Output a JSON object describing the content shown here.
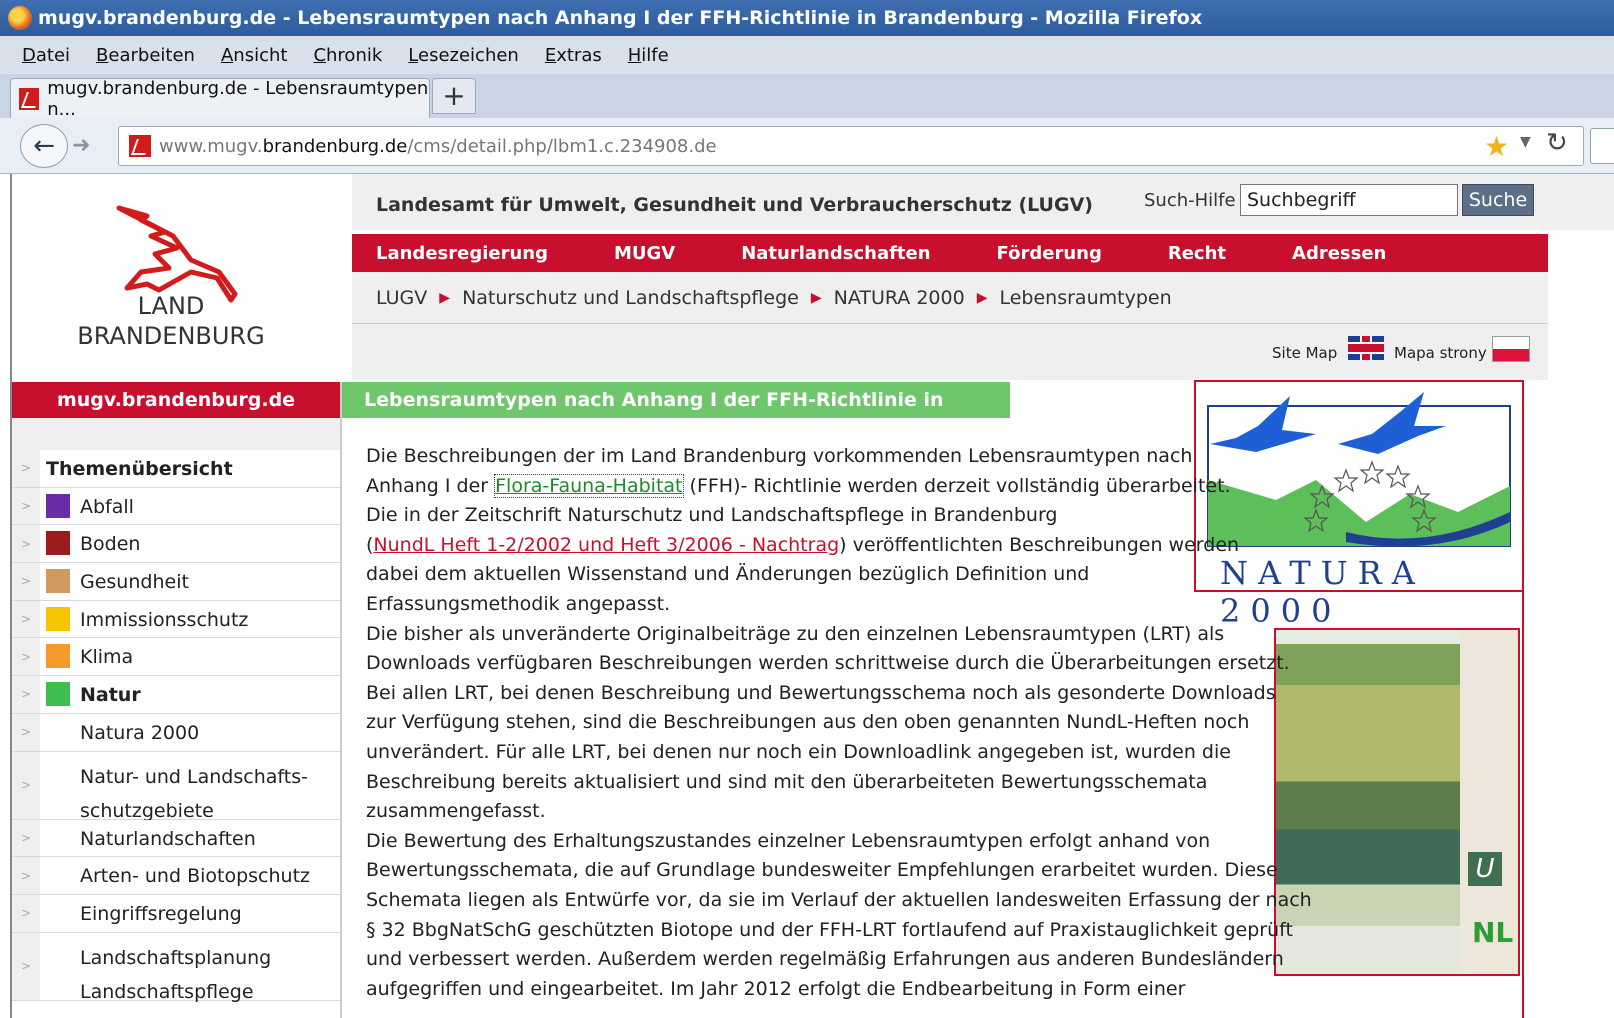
{
  "window": {
    "title": "mugv.brandenburg.de - Lebensraumtypen nach Anhang I der FFH-Richtlinie in Brandenburg - Mozilla Firefox"
  },
  "menu": [
    "Datei",
    "Bearbeiten",
    "Ansicht",
    "Chronik",
    "Lesezeichen",
    "Extras",
    "Hilfe"
  ],
  "tab": {
    "label": "mugv.brandenburg.de - Lebensraumtypen n...",
    "new_tab": "+"
  },
  "url": {
    "prefix": "www.mugv.",
    "domain": "brandenburg.de",
    "path": "/cms/detail.php/lbm1.c.234908.de"
  },
  "logo": {
    "line1": "LAND",
    "line2": "BRANDENBURG"
  },
  "header": {
    "agency": "Landesamt für Umwelt, Gesundheit und Verbraucherschutz (LUGV)",
    "search_help": "Such-Hilfe",
    "search_value": "Suchbegriff",
    "search_button": "Suche"
  },
  "mainnav": [
    "Landesregierung",
    "MUGV",
    "Naturlandschaften",
    "Förderung",
    "Recht",
    "Adressen"
  ],
  "breadcrumb": [
    "LUGV",
    "Naturschutz und Landschaftspflege",
    "NATURA 2000",
    "Lebensraumtypen"
  ],
  "lang": {
    "sitemap": "Site Map",
    "mapa": "Mapa strony"
  },
  "sidebar": {
    "head": "mugv.brandenburg.de",
    "items": [
      {
        "label": "Themenübersicht",
        "color": "",
        "style": "heading"
      },
      {
        "label": "Abfall",
        "color": "#6a2ca8"
      },
      {
        "label": "Boden",
        "color": "#9b1c1c"
      },
      {
        "label": "Gesundheit",
        "color": "#d09a5e"
      },
      {
        "label": "Immissionsschutz",
        "color": "#f6c400"
      },
      {
        "label": "Klima",
        "color": "#f39a2a"
      },
      {
        "label": "Natur",
        "color": "#3fbf4f",
        "style": "bold"
      },
      {
        "label": "Natura 2000",
        "color": ""
      },
      {
        "label": "Natur- und Landschafts-schutzgebiete",
        "line1": "Natur- und Landschafts-",
        "line2": "schutzgebiete",
        "color": ""
      },
      {
        "label": "Naturlandschaften",
        "color": ""
      },
      {
        "label": "Arten- und Biotopschutz",
        "color": ""
      },
      {
        "label": "Eingriffsregelung",
        "color": ""
      },
      {
        "label": "Landschaftsplanung",
        "line1": "Landschaftsplanung",
        "line2": "Landschaftspflege",
        "color": ""
      }
    ]
  },
  "content": {
    "title": "Lebensraumtypen nach Anhang I der FFH-Richtlinie in Brandenburg",
    "natura_logo_text": "NATURA 2000",
    "book_logo_text": "NL",
    "lines": [
      {
        "text": "Die Beschreibungen der im Land Brandenburg vorkommenden Lebensraumtypen nach"
      },
      {
        "pre": "Anhang I der ",
        "link": "Flora-Fauna-Habitat",
        "post": " (FFH)- Richtlinie werden derzeit vollständig überarbeitet."
      },
      {
        "text": "Die in der Zeitschrift Naturschutz und Landschaftspflege in Brandenburg"
      },
      {
        "pre": "(",
        "link": "NundL Heft 1-2/2002 und Heft 3/2006 - Nachtrag",
        "post": ") veröffentlichten Beschreibungen werden"
      },
      {
        "text": "dabei dem aktuellen Wissenstand und Änderungen bezüglich Definition und"
      },
      {
        "text": "Erfassungsmethodik angepasst."
      },
      {
        "text": "Die bisher als unveränderte Originalbeiträge zu den einzelnen  Lebensraumtypen (LRT) als"
      },
      {
        "text": "Downloads verfügbaren Beschreibungen werden schrittweise durch die Überarbeitungen ersetzt."
      },
      {
        "text": "Bei allen LRT, bei denen Beschreibung und Bewertungsschema noch als gesonderte Downloads"
      },
      {
        "text": "zur Verfügung stehen, sind die Beschreibungen aus den oben genannten NundL-Heften noch"
      },
      {
        "text": "unverändert. Für alle LRT, bei denen nur noch ein Downloadlink angegeben ist, wurden die"
      },
      {
        "text": "Beschreibung bereits aktualisiert und sind mit den überarbeiteten Bewertungsschemata"
      },
      {
        "text": "zusammengefasst."
      },
      {
        "text": "Die Bewertung des Erhaltungszustandes einzelner Lebensraumtypen erfolgt anhand von"
      },
      {
        "text": "Bewertungsschemata, die auf Grundlage bundesweiter Empfehlungen erarbeitet wurden. Diese"
      },
      {
        "text": "Schemata liegen als Entwürfe vor, da sie im Verlauf der aktuellen landesweiten Erfassung der nach"
      },
      {
        "text": "§ 32 BbgNatSchG geschützten Biotope und der FFH-LRT fortlaufend auf Praxistauglichkeit geprüft"
      },
      {
        "text": "und verbessert werden. Außerdem werden regelmäßig Erfahrungen aus anderen Bundesländern"
      },
      {
        "text": "aufgegriffen und eingearbeitet. Im Jahr 2012 erfolgt die Endbearbeitung in Form einer"
      }
    ]
  }
}
